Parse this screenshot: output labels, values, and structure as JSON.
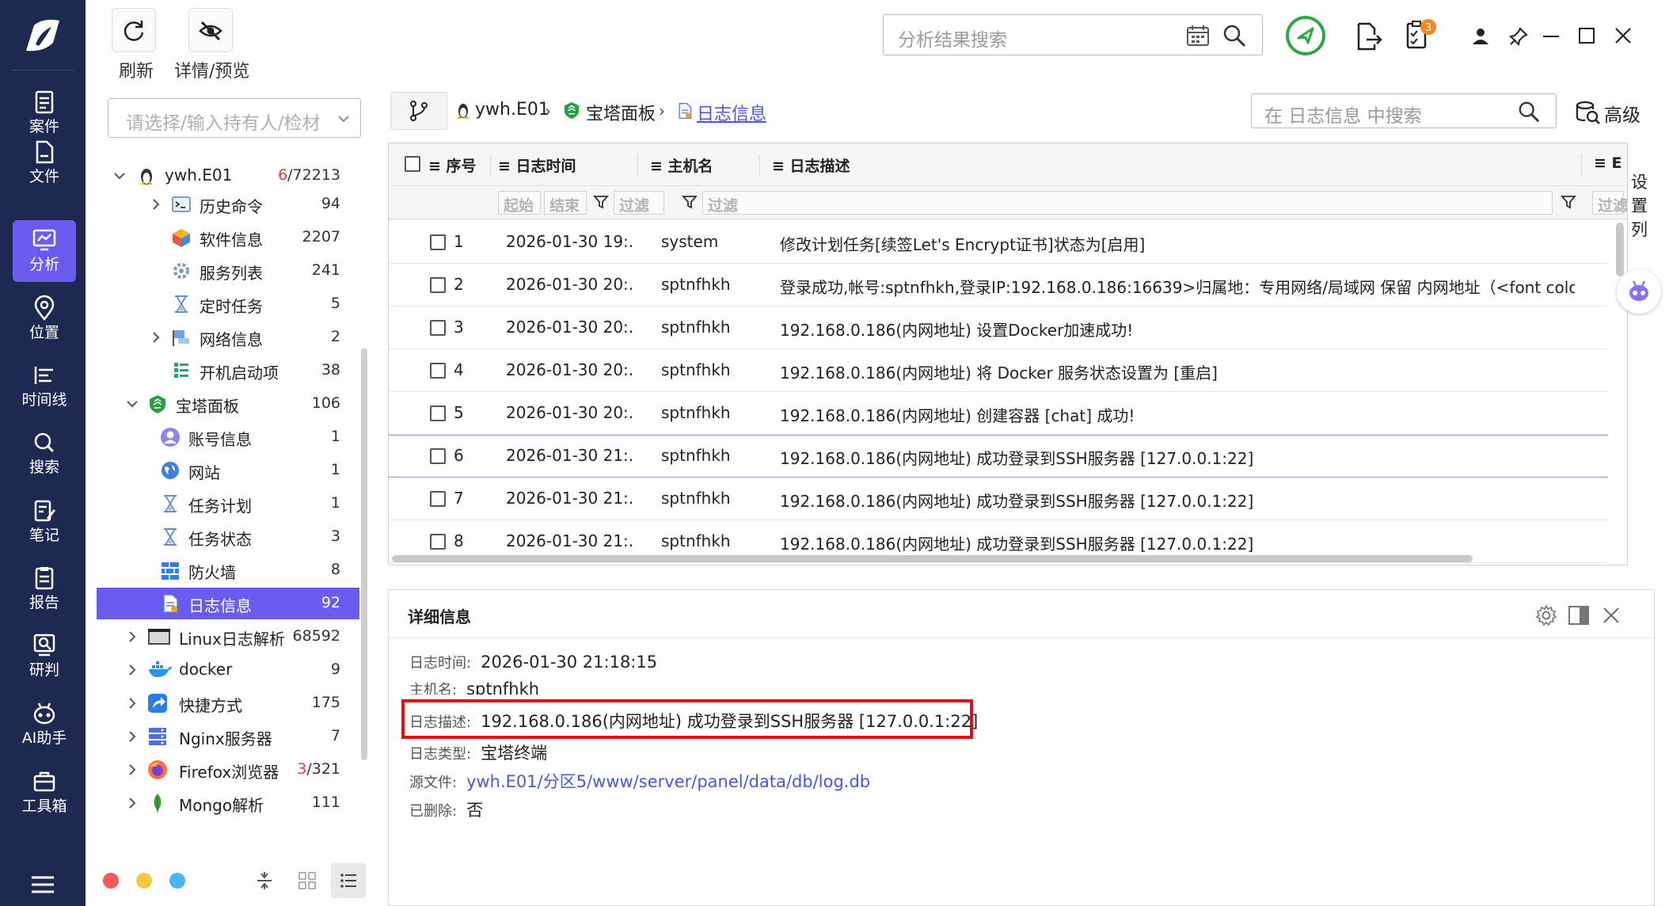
{
  "nav": {
    "items": [
      {
        "label": "案件",
        "icon": "case-icon"
      },
      {
        "label": "文件",
        "icon": "file-icon"
      },
      {
        "label": "分析",
        "icon": "analysis-icon",
        "active": true
      },
      {
        "label": "位置",
        "icon": "location-icon"
      },
      {
        "label": "时间线",
        "icon": "timeline-icon"
      },
      {
        "label": "搜索",
        "icon": "search-icon"
      },
      {
        "label": "笔记",
        "icon": "note-icon"
      },
      {
        "label": "报告",
        "icon": "report-icon"
      },
      {
        "label": "研判",
        "icon": "judge-icon"
      },
      {
        "label": "AI助手",
        "icon": "ai-assistant-icon"
      },
      {
        "label": "工具箱",
        "icon": "toolbox-icon"
      }
    ]
  },
  "toolbar": {
    "refresh_label": "刷新",
    "detail_preview_label": "详情/预览",
    "search_placeholder": "分析结果搜索",
    "notification_count": "3"
  },
  "tree": {
    "owner_placeholder": "请选择/输入持有人/检材",
    "items": [
      {
        "label": "ywh.E01",
        "count_red": "6",
        "count": "/72213",
        "icon": "linux-icon"
      },
      {
        "label": "历史命令",
        "count": "94",
        "icon": "terminal-icon"
      },
      {
        "label": "软件信息",
        "count": "2207",
        "icon": "software-icon"
      },
      {
        "label": "服务列表",
        "count": "241",
        "icon": "service-icon"
      },
      {
        "label": "定时任务",
        "count": "5",
        "icon": "hourglass-icon"
      },
      {
        "label": "网络信息",
        "count": "2",
        "icon": "network-icon"
      },
      {
        "label": "开机启动项",
        "count": "38",
        "icon": "startup-icon"
      },
      {
        "label": "宝塔面板",
        "count": "106",
        "icon": "baota-icon"
      },
      {
        "label": "账号信息",
        "count": "1",
        "icon": "account-icon"
      },
      {
        "label": "网站",
        "count": "1",
        "icon": "website-icon"
      },
      {
        "label": "任务计划",
        "count": "1",
        "icon": "hourglass-icon"
      },
      {
        "label": "任务状态",
        "count": "3",
        "icon": "hourglass-icon"
      },
      {
        "label": "防火墙",
        "count": "8",
        "icon": "firewall-icon"
      },
      {
        "label": "日志信息",
        "count": "92",
        "icon": "log-icon"
      },
      {
        "label": "Linux日志解析",
        "count": "68592",
        "icon": "log-file-icon"
      },
      {
        "label": "docker",
        "count": "9",
        "icon": "docker-icon"
      },
      {
        "label": "快捷方式",
        "count": "175",
        "icon": "shortcut-icon"
      },
      {
        "label": "Nginx服务器",
        "count": "7",
        "icon": "server-icon"
      },
      {
        "label": "Firefox浏览器",
        "count_red": "3",
        "count": "/321",
        "icon": "firefox-icon"
      },
      {
        "label": "Mongo解析",
        "count": "111",
        "icon": "mongo-icon"
      }
    ]
  },
  "breadcrumb": {
    "items": [
      "ywh.E01",
      "宝塔面板",
      "日志信息"
    ],
    "search_placeholder": "在 日志信息 中搜索",
    "advanced_label": "高级"
  },
  "table": {
    "headers": [
      "序号",
      "日志时间",
      "主机名",
      "日志描述"
    ],
    "filter_start": "起始",
    "filter_end": "结束",
    "filter_text": "过滤",
    "settings_text": [
      "设",
      "置",
      "列"
    ],
    "rows": [
      {
        "no": "1",
        "time": "2026-01-30 19:...",
        "host": "system",
        "desc": "修改计划任务[续签Let's Encrypt证书]状态为[启用]"
      },
      {
        "no": "2",
        "time": "2026-01-30 20:...",
        "host": "sptnfhkh",
        "desc": "登录成功,帐号:sptnfhkh,登录IP:192.168.0.186:16639>归属地：专用网络/局域网 保留 内网地址（<font color..."
      },
      {
        "no": "3",
        "time": "2026-01-30 20:...",
        "host": "sptnfhkh",
        "desc": "192.168.0.186(内网地址) 设置Docker加速成功!"
      },
      {
        "no": "4",
        "time": "2026-01-30 20:...",
        "host": "sptnfhkh",
        "desc": "192.168.0.186(内网地址) 将 Docker 服务状态设置为 [重启]"
      },
      {
        "no": "5",
        "time": "2026-01-30 20:...",
        "host": "sptnfhkh",
        "desc": "192.168.0.186(内网地址) 创建容器 [chat] 成功!"
      },
      {
        "no": "6",
        "time": "2026-01-30 21:...",
        "host": "sptnfhkh",
        "desc": "192.168.0.186(内网地址) 成功登录到SSH服务器 [127.0.0.1:22]"
      },
      {
        "no": "7",
        "time": "2026-01-30 21:...",
        "host": "sptnfhkh",
        "desc": "192.168.0.186(内网地址) 成功登录到SSH服务器 [127.0.0.1:22]"
      },
      {
        "no": "8",
        "time": "2026-01-30 21:...",
        "host": "sptnfhkh",
        "desc": "192.168.0.186(内网地址) 成功登录到SSH服务器 [127.0.0.1:22]"
      }
    ]
  },
  "detail": {
    "title": "详细信息",
    "fields": [
      {
        "key": "日志时间:",
        "value": "2026-01-30 21:18:15"
      },
      {
        "key": "主机名:",
        "value": "sptnfhkh"
      },
      {
        "key": "日志描述:",
        "value": "192.168.0.186(内网地址) 成功登录到SSH服务器 [127.0.0.1:22]"
      },
      {
        "key": "日志类型:",
        "value": "宝塔终端"
      },
      {
        "key": "源文件:",
        "value": "ywh.E01/分区5/www/server/panel/data/db/log.db"
      },
      {
        "key": "已删除:",
        "value": "否"
      }
    ]
  },
  "colors": {
    "nav_bg": "#1e2952",
    "accent": "#6a5cf0",
    "link": "#4b56d8",
    "highlight_border": "#e01010"
  }
}
